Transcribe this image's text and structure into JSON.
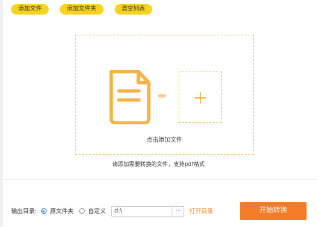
{
  "toolbar": {
    "add_file": "添加文件",
    "add_folder": "添加文件夹",
    "clear_list": "清空列表"
  },
  "drop_zone": {
    "caption": "点击添加文件",
    "doc_icon": "document-icon",
    "arrows": "»»",
    "plus_icon": "plus-icon"
  },
  "hint": "请添加需要转换的文件，支持pdf格式",
  "output": {
    "label": "输出目录:",
    "option_source": "原文件夹",
    "option_custom": "自定义",
    "selected": "原文件夹",
    "path_value": "d:\\",
    "browse_label": "···",
    "open_dir": "打开目录"
  },
  "start_button": "开始转换",
  "colors": {
    "accent_yellow": "#f7d21e",
    "accent_orange": "#f47b28",
    "dash_border": "#f5c97a",
    "radio_blue": "#3a8ee6"
  }
}
